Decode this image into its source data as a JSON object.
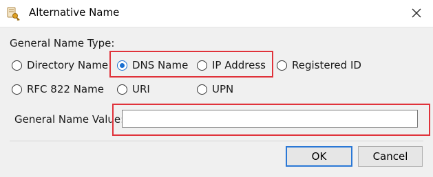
{
  "window": {
    "title": "Alternative Name",
    "icon": "certificate-key-icon",
    "close_icon": "close-icon"
  },
  "general_name_type": {
    "label": "General Name Type:",
    "options": [
      {
        "label": "Directory Name",
        "selected": false
      },
      {
        "label": "DNS Name",
        "selected": true
      },
      {
        "label": "IP Address",
        "selected": false
      },
      {
        "label": "Registered ID",
        "selected": false
      },
      {
        "label": "RFC 822 Name",
        "selected": false
      },
      {
        "label": "URI",
        "selected": false
      },
      {
        "label": "UPN",
        "selected": false
      }
    ]
  },
  "general_name_value": {
    "label": "General Name Value:",
    "value": "",
    "placeholder": ""
  },
  "buttons": {
    "ok": "OK",
    "cancel": "Cancel"
  },
  "colors": {
    "accent": "#1a6fd1",
    "highlight": "#e0323a",
    "default_button_border": "#2a78d6"
  }
}
